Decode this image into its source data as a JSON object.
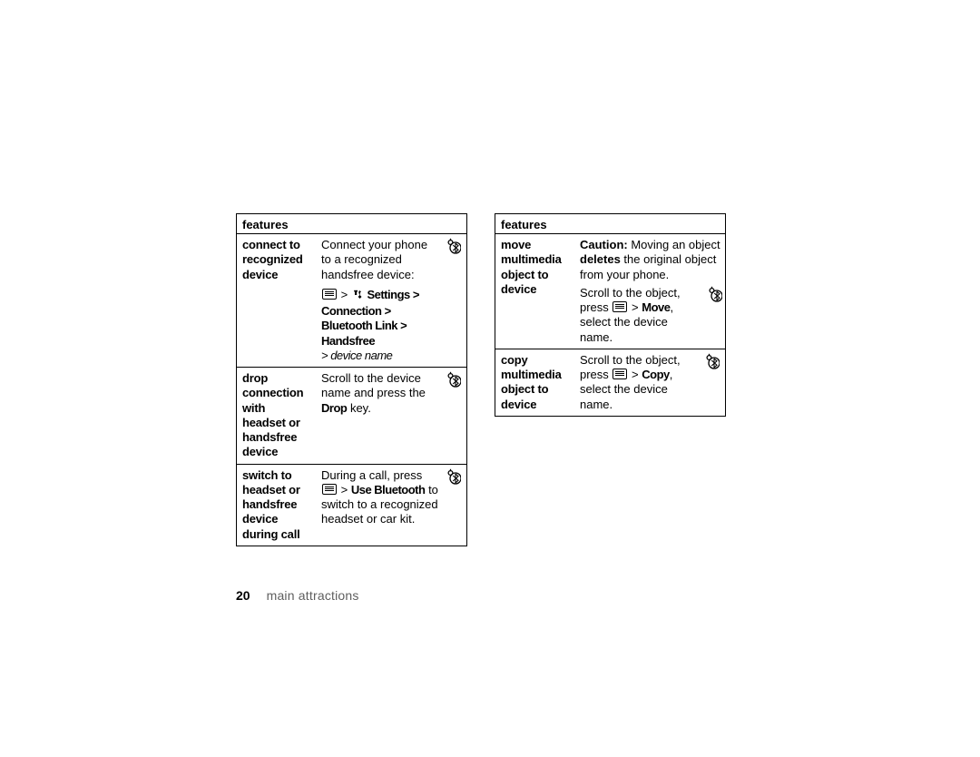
{
  "header": "features",
  "left_table": [
    {
      "feature": "connect to recognized device",
      "desc_lines": [
        {
          "t": "Connect your phone to a recognized handsfree device:"
        }
      ],
      "nav": {
        "prefix_menu": true,
        "tools_icon": true,
        "path": "Settings > Connection > Bluetooth Link > Handsfree",
        "tail_italic": "> device name"
      },
      "bt_icon": true
    },
    {
      "feature": "drop connection with headset or handsfree device",
      "desc_lines": [
        {
          "t": "Scroll to the device name and press the "
        },
        {
          "cond": "Drop"
        },
        {
          "t": " key."
        }
      ],
      "bt_icon": true
    },
    {
      "feature": "switch to headset or handsfree device during call",
      "switch_block": {
        "line1": "During a call, press",
        "use_bt": "Use Bluetooth",
        "after": " to switch to a recognized headset or car kit."
      },
      "bt_icon": true
    }
  ],
  "right_table": [
    {
      "feature": "move multimedia object to device",
      "caution_bold1": "Caution:",
      "caution_text1": " Moving an object ",
      "caution_bold2": "deletes",
      "caution_text2": " the original object from your phone.",
      "scroll": "Scroll to the object,",
      "press_word": "press ",
      "action": "Move",
      "tail": "select the device name.",
      "bt_icon": true
    },
    {
      "feature": "copy multimedia object to device",
      "scroll": "Scroll to the object,",
      "press_word": "press ",
      "action": "Copy",
      "tail": "select the device name.",
      "bt_icon": true
    }
  ],
  "footer": {
    "page": "20",
    "section": "main attractions"
  }
}
